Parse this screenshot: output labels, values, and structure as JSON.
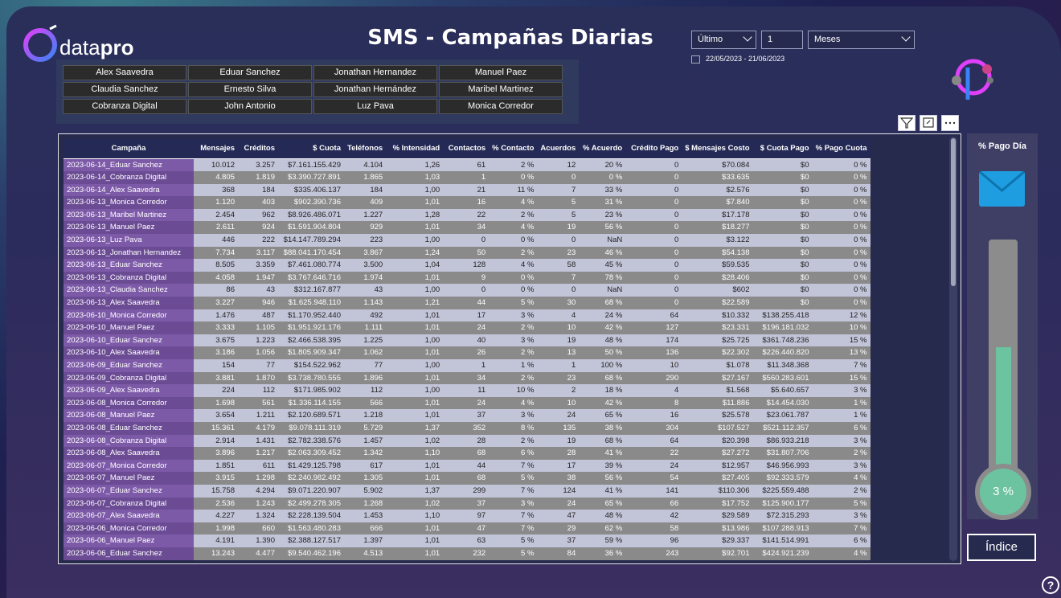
{
  "brand": {
    "logo_text_a": "data",
    "logo_text_b": "pro"
  },
  "title": "SMS - Campañas Diarias",
  "agents": [
    [
      "Alex Saavedra",
      "Eduar Sanchez",
      "Jonathan Hernandez",
      "Manuel Paez"
    ],
    [
      "Claudia Sanchez",
      "Ernesto Silva",
      "Jonathan Hernández",
      "Maribel Martinez"
    ],
    [
      "Cobranza Digital",
      "John Antonio",
      "Luz Pava",
      "Monica Corredor"
    ]
  ],
  "filters": {
    "period_mode": "Último",
    "period_count": "1",
    "period_unit": "Meses",
    "date_range": "22/05/2023 - 21/06/2023"
  },
  "table": {
    "columns": [
      "Campaña",
      "Mensajes",
      "Créditos",
      "$ Cuota",
      "Teléfonos",
      "% Intensidad",
      "Contactos",
      "% Contacto",
      "Acuerdos",
      "% Acuerdo",
      "Crédito Pago",
      "$ Mensajes Costo",
      "$ Cuota Pago",
      "% Pago Cuota"
    ],
    "rows": [
      [
        "2023-06-14_Eduar Sanchez",
        "10.012",
        "3.257",
        "$7.161.155.429",
        "4.104",
        "1,26",
        "61",
        "2 %",
        "12",
        "20 %",
        "0",
        "$70.084",
        "$0",
        "0 %"
      ],
      [
        "2023-06-14_Cobranza Digital",
        "4.805",
        "1.819",
        "$3.390.727.891",
        "1.865",
        "1,03",
        "1",
        "0 %",
        "0",
        "0 %",
        "0",
        "$33.635",
        "$0",
        "0 %"
      ],
      [
        "2023-06-14_Alex Saavedra",
        "368",
        "184",
        "$335.406.137",
        "184",
        "1,00",
        "21",
        "11 %",
        "7",
        "33 %",
        "0",
        "$2.576",
        "$0",
        "0 %"
      ],
      [
        "2023-06-13_Monica Corredor",
        "1.120",
        "403",
        "$902.390.736",
        "409",
        "1,01",
        "16",
        "4 %",
        "5",
        "31 %",
        "0",
        "$7.840",
        "$0",
        "0 %"
      ],
      [
        "2023-06-13_Maribel Martinez",
        "2.454",
        "962",
        "$8.926.486.071",
        "1.227",
        "1,28",
        "22",
        "2 %",
        "5",
        "23 %",
        "0",
        "$17.178",
        "$0",
        "0 %"
      ],
      [
        "2023-06-13_Manuel Paez",
        "2.611",
        "924",
        "$1.591.904.804",
        "929",
        "1,01",
        "34",
        "4 %",
        "19",
        "56 %",
        "0",
        "$18.277",
        "$0",
        "0 %"
      ],
      [
        "2023-06-13_Luz Pava",
        "446",
        "222",
        "$14.147.789.294",
        "223",
        "1,00",
        "0",
        "0 %",
        "0",
        "NaN",
        "0",
        "$3.122",
        "$0",
        "0 %"
      ],
      [
        "2023-06-13_Jonathan Hernandez",
        "7.734",
        "3.117",
        "$88.041.170.454",
        "3.867",
        "1,24",
        "50",
        "2 %",
        "23",
        "46 %",
        "0",
        "$54.138",
        "$0",
        "0 %"
      ],
      [
        "2023-06-13_Eduar Sanchez",
        "8.505",
        "3.359",
        "$7.461.080.774",
        "3.500",
        "1,04",
        "128",
        "4 %",
        "58",
        "45 %",
        "0",
        "$59.535",
        "$0",
        "0 %"
      ],
      [
        "2023-06-13_Cobranza Digital",
        "4.058",
        "1.947",
        "$3.767.646.716",
        "1.974",
        "1,01",
        "9",
        "0 %",
        "7",
        "78 %",
        "0",
        "$28.406",
        "$0",
        "0 %"
      ],
      [
        "2023-06-13_Claudia Sanchez",
        "86",
        "43",
        "$312.167.877",
        "43",
        "1,00",
        "0",
        "0 %",
        "0",
        "NaN",
        "0",
        "$602",
        "$0",
        "0 %"
      ],
      [
        "2023-06-13_Alex Saavedra",
        "3.227",
        "946",
        "$1.625.948.110",
        "1.143",
        "1,21",
        "44",
        "5 %",
        "30",
        "68 %",
        "0",
        "$22.589",
        "$0",
        "0 %"
      ],
      [
        "2023-06-10_Monica Corredor",
        "1.476",
        "487",
        "$1.170.952.440",
        "492",
        "1,01",
        "17",
        "3 %",
        "4",
        "24 %",
        "64",
        "$10.332",
        "$138.255.418",
        "12 %"
      ],
      [
        "2023-06-10_Manuel Paez",
        "3.333",
        "1.105",
        "$1.951.921.176",
        "1.111",
        "1,01",
        "24",
        "2 %",
        "10",
        "42 %",
        "127",
        "$23.331",
        "$196.181.032",
        "10 %"
      ],
      [
        "2023-06-10_Eduar Sanchez",
        "3.675",
        "1.223",
        "$2.466.538.395",
        "1.225",
        "1,00",
        "40",
        "3 %",
        "19",
        "48 %",
        "174",
        "$25.725",
        "$361.748.236",
        "15 %"
      ],
      [
        "2023-06-10_Alex Saavedra",
        "3.186",
        "1.056",
        "$1.805.909.347",
        "1.062",
        "1,01",
        "26",
        "2 %",
        "13",
        "50 %",
        "136",
        "$22.302",
        "$226.440.820",
        "13 %"
      ],
      [
        "2023-06-09_Eduar Sanchez",
        "154",
        "77",
        "$154.522.962",
        "77",
        "1,00",
        "1",
        "1 %",
        "1",
        "100 %",
        "10",
        "$1.078",
        "$11.348.368",
        "7 %"
      ],
      [
        "2023-06-09_Cobranza Digital",
        "3.881",
        "1.870",
        "$3.738.780.555",
        "1.896",
        "1,01",
        "34",
        "2 %",
        "23",
        "68 %",
        "290",
        "$27.167",
        "$560.283.601",
        "15 %"
      ],
      [
        "2023-06-09_Alex Saavedra",
        "224",
        "112",
        "$171.985.902",
        "112",
        "1,00",
        "11",
        "10 %",
        "2",
        "18 %",
        "4",
        "$1.568",
        "$5.640.657",
        "3 %"
      ],
      [
        "2023-06-08_Monica Corredor",
        "1.698",
        "561",
        "$1.336.114.155",
        "566",
        "1,01",
        "24",
        "4 %",
        "10",
        "42 %",
        "8",
        "$11.886",
        "$14.454.030",
        "1 %"
      ],
      [
        "2023-06-08_Manuel Paez",
        "3.654",
        "1.211",
        "$2.120.689.571",
        "1.218",
        "1,01",
        "37",
        "3 %",
        "24",
        "65 %",
        "16",
        "$25.578",
        "$23.061.787",
        "1 %"
      ],
      [
        "2023-06-08_Eduar Sanchez",
        "15.361",
        "4.179",
        "$9.078.111.319",
        "5.729",
        "1,37",
        "352",
        "8 %",
        "135",
        "38 %",
        "304",
        "$107.527",
        "$521.112.357",
        "6 %"
      ],
      [
        "2023-06-08_Cobranza Digital",
        "2.914",
        "1.431",
        "$2.782.338.576",
        "1.457",
        "1,02",
        "28",
        "2 %",
        "19",
        "68 %",
        "64",
        "$20.398",
        "$86.933.218",
        "3 %"
      ],
      [
        "2023-06-08_Alex Saavedra",
        "3.896",
        "1.217",
        "$2.063.309.452",
        "1.342",
        "1,10",
        "68",
        "6 %",
        "28",
        "41 %",
        "22",
        "$27.272",
        "$31.807.706",
        "2 %"
      ],
      [
        "2023-06-07_Monica Corredor",
        "1.851",
        "611",
        "$1.429.125.798",
        "617",
        "1,01",
        "44",
        "7 %",
        "17",
        "39 %",
        "24",
        "$12.957",
        "$46.956.993",
        "3 %"
      ],
      [
        "2023-06-07_Manuel Paez",
        "3.915",
        "1.298",
        "$2.240.982.492",
        "1.305",
        "1,01",
        "68",
        "5 %",
        "38",
        "56 %",
        "54",
        "$27.405",
        "$92.333.579",
        "4 %"
      ],
      [
        "2023-06-07_Eduar Sanchez",
        "15.758",
        "4.294",
        "$9.071.220.907",
        "5.902",
        "1,37",
        "299",
        "7 %",
        "124",
        "41 %",
        "141",
        "$110.306",
        "$225.559.488",
        "2 %"
      ],
      [
        "2023-06-07_Cobranza Digital",
        "2.536",
        "1.243",
        "$2.499.278.305",
        "1.268",
        "1,02",
        "37",
        "3 %",
        "24",
        "65 %",
        "66",
        "$17.752",
        "$125.900.177",
        "5 %"
      ],
      [
        "2023-06-07_Alex Saavedra",
        "4.227",
        "1.324",
        "$2.228.139.504",
        "1.453",
        "1,10",
        "97",
        "7 %",
        "47",
        "48 %",
        "42",
        "$29.589",
        "$72.315.293",
        "3 %"
      ],
      [
        "2023-06-06_Monica Corredor",
        "1.998",
        "660",
        "$1.563.480.283",
        "666",
        "1,01",
        "47",
        "7 %",
        "29",
        "62 %",
        "58",
        "$13.986",
        "$107.288.913",
        "7 %"
      ],
      [
        "2023-06-06_Manuel Paez",
        "4.191",
        "1.390",
        "$2.388.127.517",
        "1.397",
        "1,01",
        "63",
        "5 %",
        "37",
        "59 %",
        "96",
        "$29.337",
        "$141.514.991",
        "6 %"
      ],
      [
        "2023-06-06_Eduar Sanchez",
        "13.243",
        "4.477",
        "$9.540.462.196",
        "4.513",
        "1,01",
        "232",
        "5 %",
        "84",
        "36 %",
        "243",
        "$92.701",
        "$424.921.239",
        "4 %"
      ]
    ]
  },
  "gauge": {
    "title": "% Pago Día",
    "value_label": "3 %",
    "fill_fraction": 0.55
  },
  "buttons": {
    "indice": "Índice",
    "help": "?"
  },
  "colors": {
    "accent_purple": "#7d5aa8",
    "gauge_green": "#6cc3a0",
    "envelope_blue": "#1e9ee0"
  }
}
